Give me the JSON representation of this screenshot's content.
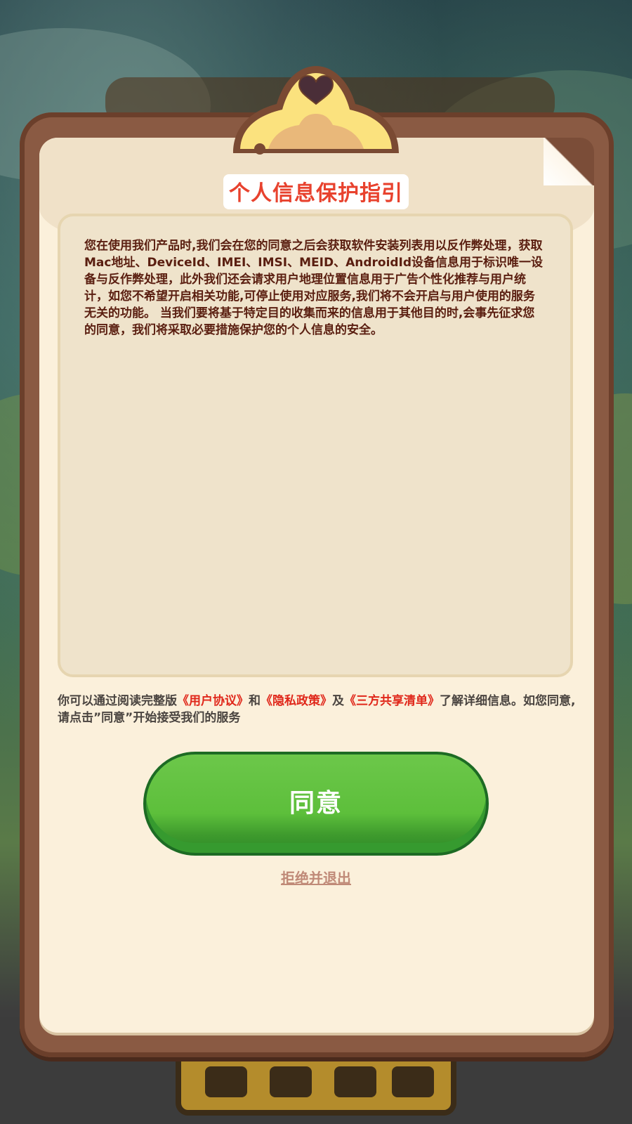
{
  "dialog": {
    "title": "个人信息保护指引",
    "notice": "您在使用我们产品时,我们会在您的同意之后会获取软件安装列表用以反作弊处理，获取Mac地址、DeviceId、IMEI、IMSI、MEID、AndroidId设备信息用于标识唯一设备与反作弊处理，此外我们还会请求用户地理位置信息用于广告个性化推荐与用户统计，如您不希望开启相关功能,可停止使用对应服务,我们将不会开启与用户使用的服务无关的功能。 当我们要将基于特定目的收集而来的信息用于其他目的时,会事先征求您的同意，我们将采取必要措施保护您的个人信息的安全。",
    "info_prefix": "你可以通过阅读完整版",
    "link_user_agreement": "《用户协议》",
    "conj_and": "和",
    "link_privacy_policy": "《隐私政策》",
    "conj_also": "及",
    "link_third_party_list": "《三方共享清单》",
    "info_suffix": "了解详细信息。如您同意,请点击”同意”开始接受我们的服务",
    "agree_label": "同意",
    "decline_label": "拒绝并退出"
  },
  "colors": {
    "title_red": "#e8422e",
    "link_red": "#e0271a",
    "button_green": "#5dbf3b",
    "board_brown": "#8a5a43",
    "paper_cream": "#fbf0db",
    "decline_text": "#c08a78"
  },
  "icons": {
    "clip": "heart-clip-icon",
    "corner": "page-fold-icon"
  }
}
